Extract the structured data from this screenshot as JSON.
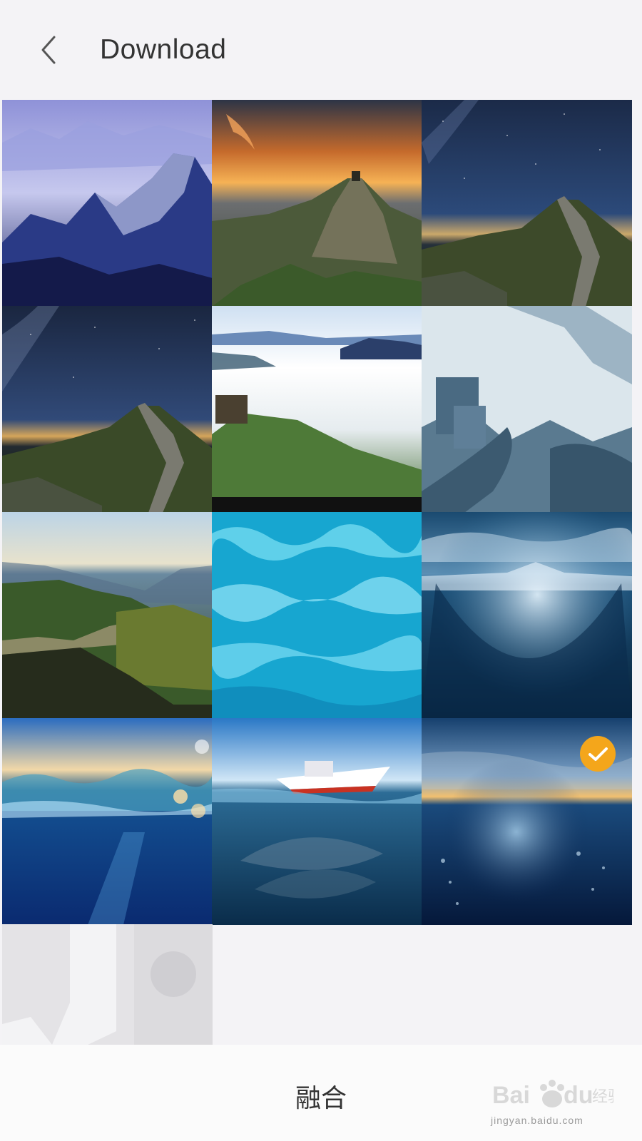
{
  "header": {
    "title": "Download",
    "back_icon": "chevron-left-icon"
  },
  "grid": {
    "tiles": [
      {
        "row": 1,
        "col": 1,
        "subject": "misty great wall mountains",
        "selected": false
      },
      {
        "row": 1,
        "col": 2,
        "subject": "sunset watchtower peak",
        "selected": false
      },
      {
        "row": 1,
        "col": 3,
        "subject": "night sky great wall",
        "selected": false
      },
      {
        "row": 2,
        "col": 1,
        "subject": "milky way great wall",
        "selected": false
      },
      {
        "row": 2,
        "col": 2,
        "subject": "clouds over mountain",
        "selected": false
      },
      {
        "row": 2,
        "col": 3,
        "subject": "great wall watercolor",
        "selected": false
      },
      {
        "row": 3,
        "col": 1,
        "subject": "green mountains great wall",
        "selected": false
      },
      {
        "row": 3,
        "col": 2,
        "subject": "turquoise water ripples",
        "selected": false
      },
      {
        "row": 3,
        "col": 3,
        "subject": "underwater light rays",
        "selected": false
      },
      {
        "row": 4,
        "col": 1,
        "subject": "ocean wave split view",
        "selected": false
      },
      {
        "row": 4,
        "col": 2,
        "subject": "boat and fish school",
        "selected": false
      },
      {
        "row": 4,
        "col": 3,
        "subject": "ocean sunset underwater",
        "selected": true
      },
      {
        "row": 5,
        "col": 1,
        "subject": "placeholder",
        "selected": false
      }
    ],
    "selected_icon": "checkmark-icon"
  },
  "bottom": {
    "merge_label": "融合"
  },
  "watermark": {
    "brand": "Bai du 经验",
    "url": "jingyan.baidu.com"
  },
  "colors": {
    "background": "#f4f3f6",
    "check_badge": "#f4a61b",
    "text": "#333333"
  }
}
